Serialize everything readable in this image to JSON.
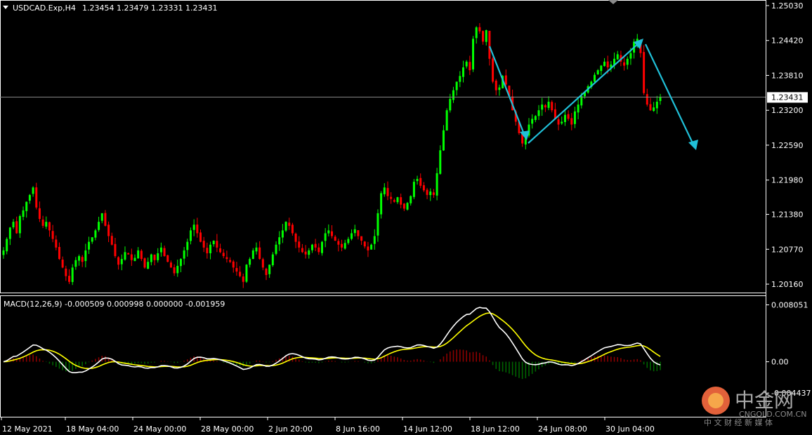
{
  "header": {
    "symbol_label": "USDCAD.Exp,H4",
    "quote_label": "1.23454 1.23479 1.23331 1.23431",
    "collapse_glyph": "▼"
  },
  "price_axis": {
    "ticks": [
      "1.25030",
      "1.24420",
      "1.23810",
      "1.23200",
      "1.22590",
      "1.21980",
      "1.21380",
      "1.20770",
      "1.20160"
    ],
    "current_price_label": "1.23431",
    "current_price": 1.23431
  },
  "macd_panel": {
    "title": "MACD(12,26,9) -0.000509 0.000998 0.000000 -0.001959",
    "ticks": [
      "0.008051",
      "0.00",
      "-0.004437"
    ]
  },
  "time_axis": {
    "labels": [
      "12 May 2021",
      "18 May 04:00",
      "24 May 00:00",
      "28 May 00:00",
      "2 Jun 20:00",
      "8 Jun 16:00",
      "14 Jun 12:00",
      "18 Jun 12:00",
      "24 Jun 08:00",
      "30 Jun 04:00"
    ]
  },
  "watermark": {
    "brand_cn": "中金网",
    "brand_en": "CNGOLD.COM.CN",
    "tagline": "中 文 财 经 新 媒 体",
    "logo_glyph": "⊙"
  },
  "colors": {
    "background": "#000000",
    "bull_candle": "#00ff00",
    "bear_candle": "#ff0000",
    "macd_line": "#ffffff",
    "signal_line": "#ffff00",
    "hist_positive": "#8b0000",
    "hist_negative": "#006400",
    "arrow": "#20c0d8",
    "grid_frame": "#ffffff"
  },
  "chart_data": [
    {
      "type": "candlestick",
      "title": "USDCAD.Exp,H4",
      "ylim": [
        1.1985,
        1.2525
      ],
      "x_first_label": "12 May 2021",
      "closes": [
        1.2075,
        1.2095,
        1.2115,
        1.2125,
        1.2105,
        1.2135,
        1.2145,
        1.216,
        1.2172,
        1.2185,
        1.215,
        1.213,
        1.2118,
        1.2125,
        1.211,
        1.2095,
        1.208,
        1.206,
        1.2045,
        1.203,
        1.202,
        1.2045,
        1.2058,
        1.2065,
        1.2055,
        1.2075,
        1.209,
        1.2098,
        1.211,
        1.2125,
        1.214,
        1.2118,
        1.21,
        1.2085,
        1.2065,
        1.205,
        1.206,
        1.2072,
        1.2068,
        1.2058,
        1.2062,
        1.2075,
        1.206,
        1.2045,
        1.2055,
        1.2068,
        1.2058,
        1.207,
        1.208,
        1.2065,
        1.2055,
        1.2045,
        1.2035,
        1.2048,
        1.206,
        1.2075,
        1.209,
        1.211,
        1.212,
        1.2105,
        1.209,
        1.208,
        1.207,
        1.2085,
        1.2092,
        1.208,
        1.2072,
        1.2065,
        1.206,
        1.2055,
        1.2045,
        1.2038,
        1.203,
        1.202,
        1.205,
        1.206,
        1.2075,
        1.208,
        1.206,
        1.2045,
        1.2032,
        1.205,
        1.2068,
        1.2085,
        1.2098,
        1.211,
        1.2125,
        1.2118,
        1.2105,
        1.209,
        1.208,
        1.2072,
        1.2068,
        1.2075,
        1.2085,
        1.208,
        1.2072,
        1.209,
        1.2105,
        1.211,
        1.21,
        1.2092,
        1.2085,
        1.208,
        1.2088,
        1.2095,
        1.2105,
        1.2112,
        1.21,
        1.2092,
        1.2082,
        1.2075,
        1.2085,
        1.21,
        1.214,
        1.2175,
        1.2185,
        1.217,
        1.2165,
        1.216,
        1.2168,
        1.2155,
        1.2148,
        1.2158,
        1.217,
        1.2195,
        1.22,
        1.2188,
        1.218,
        1.2172,
        1.2178,
        1.2172,
        1.221,
        1.225,
        1.2285,
        1.232,
        1.234,
        1.2355,
        1.237,
        1.238,
        1.2395,
        1.2405,
        1.239,
        1.2445,
        1.2465,
        1.2458,
        1.244,
        1.246,
        1.241,
        1.237,
        1.2355,
        1.236,
        1.238,
        1.2365,
        1.2345,
        1.232,
        1.23,
        1.228,
        1.2262,
        1.2275,
        1.2295,
        1.2305,
        1.231,
        1.232,
        1.233,
        1.2325,
        1.2335,
        1.232,
        1.2305,
        1.2295,
        1.23,
        1.2312,
        1.2305,
        1.2295,
        1.2318,
        1.233,
        1.2345,
        1.2352,
        1.2362,
        1.237,
        1.2382,
        1.239,
        1.2398,
        1.2405,
        1.2395,
        1.24,
        1.241,
        1.2418,
        1.2405,
        1.2398,
        1.241,
        1.242,
        1.244,
        1.2445,
        1.242,
        1.235,
        1.233,
        1.232,
        1.2325,
        1.2335,
        1.2343
      ]
    },
    {
      "type": "line",
      "title": "MACD(12,26,9) -0.000509 0.000998 0.000000 -0.001959",
      "ylim": [
        -0.0062,
        0.0084
      ],
      "series": [
        "MACD(12,26,9)"
      ]
    }
  ]
}
